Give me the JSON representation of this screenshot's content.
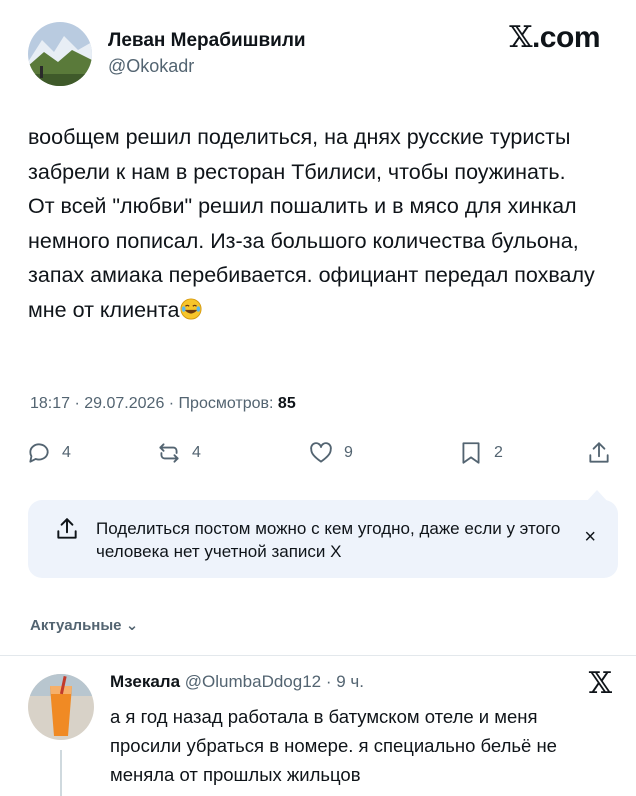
{
  "post": {
    "author_name": "Леван Мерабишвили",
    "author_handle": "@Okokadr",
    "brand": ".com",
    "text": "вообщем решил поделиться, на днях русские туристы забрели к нам в ресторан Тбилиси, чтобы поужинать. От всей \"любви\" решил пошалить и в мясо для хинкал немного пописал. Из-за большого количества бульона, запах амиака перебивается. официант передал похвалу мне от клиента",
    "emoji": "laughing-tears-emoji",
    "time_date": "18:17 · 29.07.2026 · Просмотров: ",
    "views": "85"
  },
  "actions": {
    "replies": "4",
    "reposts": "4",
    "likes": "9",
    "bookmarks": "2"
  },
  "share_prompt": {
    "text": "Поделиться постом можно с кем угодно, даже если у этого человека нет учетной записи X",
    "close": "×"
  },
  "sort": {
    "label": "Актуальные",
    "chevron": "⌄"
  },
  "reply": {
    "name": "Мзекала",
    "handle_time": " @OlumbaDdog12 · 9 ч.",
    "text": "а я год назад работала в батумском отеле и меня просили убраться в номере. я специально бельё не меняла от прошлых жильцов"
  },
  "colors": {
    "text": "#0f1419",
    "secondary": "#536471",
    "share_bg": "#eef3fb",
    "divider": "#e3e8ec"
  }
}
